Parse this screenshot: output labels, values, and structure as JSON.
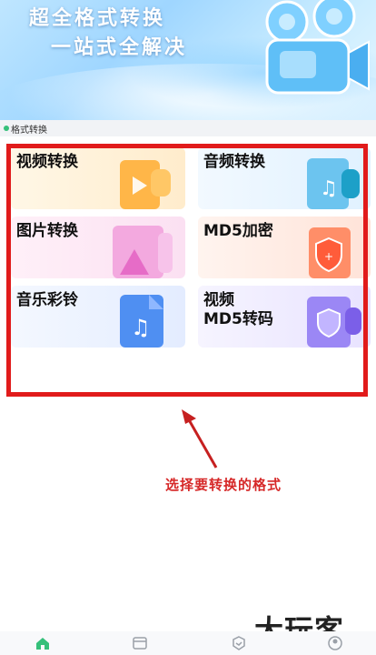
{
  "banner": {
    "line1": "超全格式转换",
    "line2": "一站式全解决"
  },
  "section": {
    "label": "格式转换"
  },
  "cards": [
    {
      "label": "视频转换",
      "icon": "video-file-icon"
    },
    {
      "label": "音频转换",
      "icon": "audio-file-icon"
    },
    {
      "label": "图片转换",
      "icon": "image-file-icon"
    },
    {
      "label": "MD5加密",
      "icon": "shield-lock-icon"
    },
    {
      "label": "音乐彩铃",
      "icon": "music-file-icon"
    },
    {
      "label": "视频",
      "label2": "MD5转码",
      "icon": "video-shield-icon"
    }
  ],
  "annotation": {
    "text": "选择要转换的格式"
  },
  "watermark": {
    "text": "大玩客"
  },
  "nav": {
    "items": [
      "home-icon",
      "folder-icon",
      "cube-icon",
      "profile-icon"
    ],
    "active_color": "#35c07a"
  },
  "colors": {
    "highlight": "#e11b1b",
    "annotation": "#d62828"
  }
}
